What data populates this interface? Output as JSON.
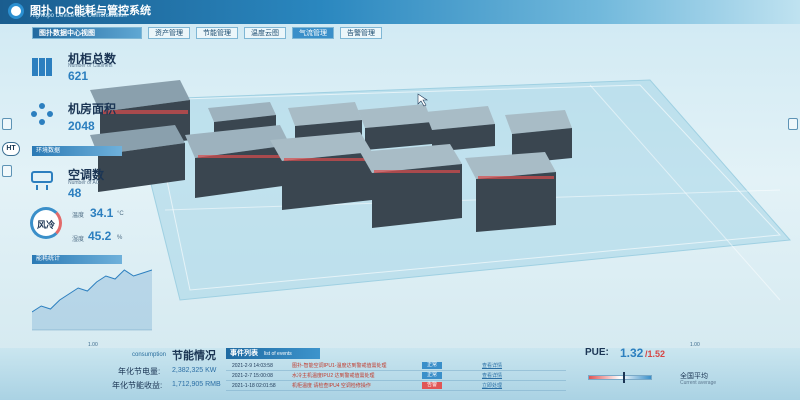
{
  "header": {
    "app_title": "图扑 IDC能耗与管控系统",
    "app_subtitle": "Hightopo Device IDC Demonstration"
  },
  "tabs": [
    {
      "label": "图扑数据中心视图"
    },
    {
      "label": "资产管理"
    },
    {
      "label": "节能管理"
    },
    {
      "label": "温度云图"
    },
    {
      "label": "气流管理"
    },
    {
      "label": "告警管理"
    }
  ],
  "ht_badge": "HT",
  "stats": {
    "cabinets": {
      "title": "机柜总数",
      "subtitle": "Number of Cabinets",
      "value": "621"
    },
    "area": {
      "title": "机房面积",
      "value": "2048"
    },
    "env_header": "环境数据",
    "ac": {
      "title": "空调数",
      "subtitle": "Number of AC",
      "value": "48"
    }
  },
  "environment": {
    "gauge_label": "风冷",
    "temp": {
      "label": "温度",
      "value": "34.1",
      "unit": "°C"
    },
    "humidity": {
      "label": "湿度",
      "value": "45.2",
      "unit": "%"
    }
  },
  "trend": {
    "header": "能耗统计",
    "points": [
      3,
      4,
      3.5,
      5,
      6,
      7,
      6.5,
      8,
      9,
      8.5,
      10,
      9,
      9.5,
      10
    ]
  },
  "energy": {
    "en_label": "consumption",
    "title": "节能情况",
    "rows": [
      {
        "label": "年化节电量:",
        "value": "2,382,325 KW"
      },
      {
        "label": "年化节能收益:",
        "value": "1,712,905 RMB"
      }
    ]
  },
  "events": {
    "title": "事件列表",
    "subtitle": "list of events",
    "rows": [
      {
        "time": "2021-2-9 14:03:58",
        "desc": "图扑-智能空调IPU1-温度达到警戒值需处理",
        "status": "正常",
        "action": "查看详情"
      },
      {
        "time": "2021-2-7 15:00:08",
        "desc": "水冷主机温度IPU2 达到警戒值需处理",
        "status": "正常",
        "action": "查看详情"
      },
      {
        "time": "2021-1-18 02:01:58",
        "desc": "机柜温度 请检查IPU4 空调检修操作",
        "status": "告警",
        "action": "立即处理"
      }
    ]
  },
  "pue": {
    "label": "PUE:",
    "value": "1.32",
    "target": "/1.52",
    "avg_label": "全国平均",
    "avg_en": "Current average",
    "marker_level": 0.55
  },
  "corners": {
    "left": "1.00",
    "right": "1.00"
  },
  "colors": {
    "accent": "#2c7fbf",
    "header": "#1a5d8f",
    "warning": "#e05555"
  }
}
